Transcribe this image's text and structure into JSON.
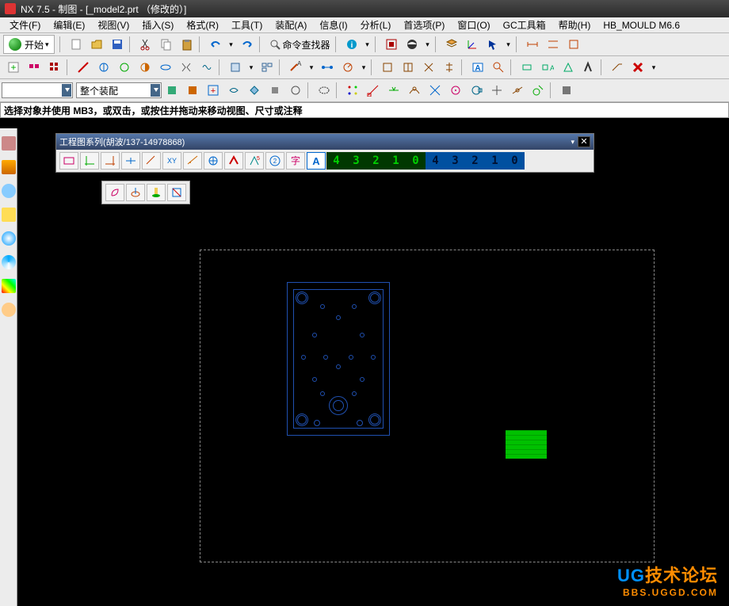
{
  "title": "NX 7.5 - 制图 - [_model2.prt （修改的）]",
  "menu": [
    "文件(F)",
    "编辑(E)",
    "视图(V)",
    "插入(S)",
    "格式(R)",
    "工具(T)",
    "装配(A)",
    "信息(I)",
    "分析(L)",
    "首选项(P)",
    "窗口(O)",
    "GC工具箱",
    "帮助(H)",
    "HB_MOULD M6.6"
  ],
  "start_label": "开始",
  "cmd_finder_label": "命令查找器",
  "assembly_dd": "整个装配",
  "prompt_text": "选择对象并使用 MB3，或双击，或按住并拖动来移动视图、尺寸或注释",
  "floating_toolbar_title": "工程图系列(胡波/137-14978868)",
  "number_buttons_dark": [
    "4",
    "3",
    "2",
    "1",
    "0"
  ],
  "number_buttons_blue": [
    "4",
    "3",
    "2",
    "1",
    "0"
  ],
  "watermark": {
    "line1_left": "UG",
    "line1_right": "技术论坛",
    "line2": "BBS.UGGD.COM"
  }
}
